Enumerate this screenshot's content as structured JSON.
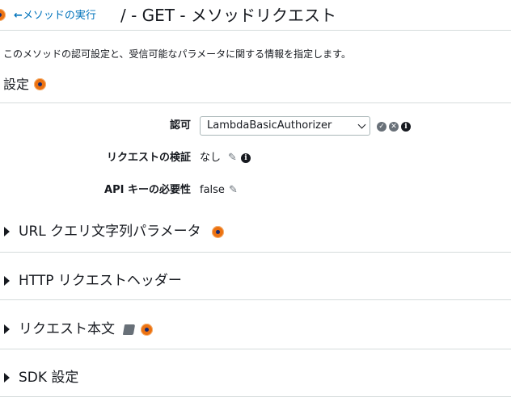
{
  "header": {
    "back_label": "メソッドの実行",
    "title": "/ - GET - メソッドリクエスト"
  },
  "description": "このメソッドの認可設定と、受信可能なパラメータに関する情報を指定します。",
  "settings": {
    "title": "設定",
    "authorization": {
      "label": "認可",
      "selected": "LambdaBasicAuthorizer"
    },
    "request_validation": {
      "label": "リクエストの検証",
      "value": "なし"
    },
    "api_key_required": {
      "label": "API キーの必要性",
      "value": "false"
    }
  },
  "sections": [
    {
      "label": "URL クエリ文字列パラメータ"
    },
    {
      "label": "HTTP リクエストヘッダー"
    },
    {
      "label": "リクエスト本文"
    },
    {
      "label": "SDK 設定"
    }
  ],
  "colors": {
    "link": "#0073bb",
    "accent": "#ec7211",
    "divider": "#d5dbdb",
    "check_icon": "#687078"
  },
  "icons": [
    "arrow-left-icon",
    "info-dot-icon",
    "check-circle-icon",
    "x-circle-icon",
    "info-icon",
    "pencil-icon",
    "book-icon",
    "caret-right-icon"
  ]
}
